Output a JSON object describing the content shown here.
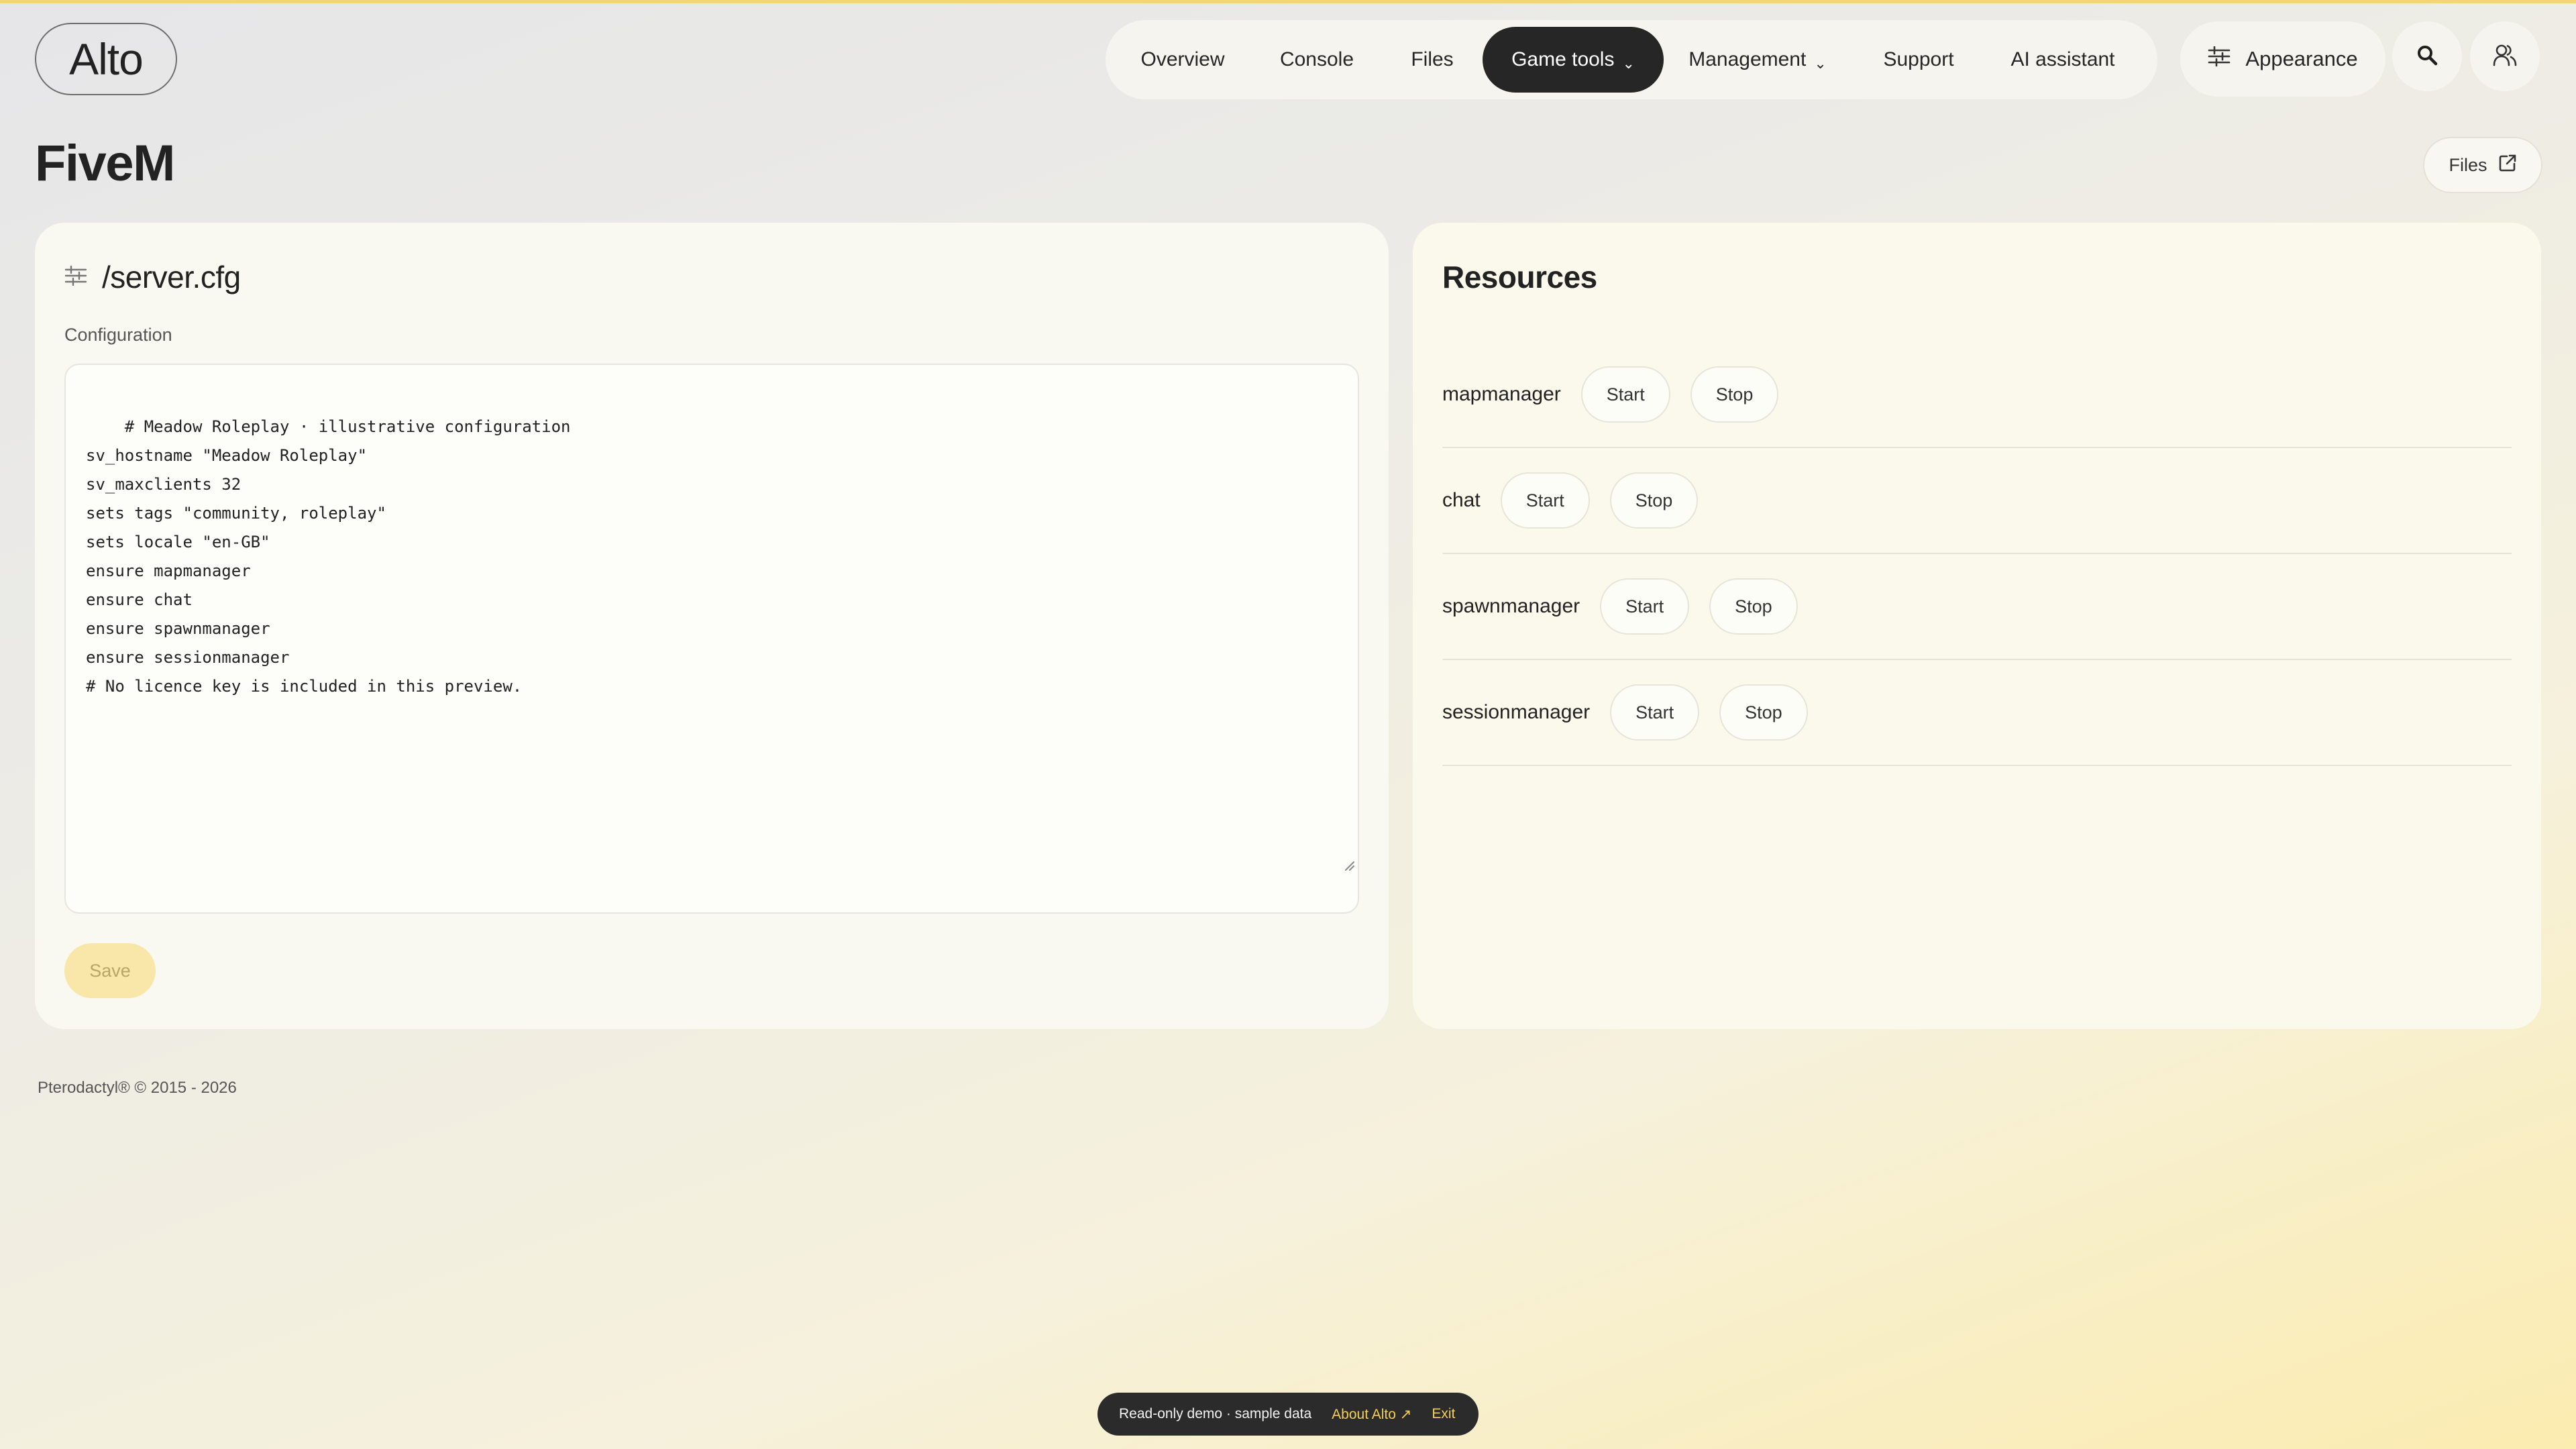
{
  "logo": {
    "text": "Alto"
  },
  "nav": {
    "items": [
      {
        "label": "Overview"
      },
      {
        "label": "Console"
      },
      {
        "label": "Files"
      },
      {
        "label": "Game tools",
        "active": true
      },
      {
        "label": "Management"
      },
      {
        "label": "Support"
      },
      {
        "label": "AI assistant"
      }
    ],
    "appearance_label": "Appearance"
  },
  "page": {
    "title": "FiveM",
    "files_link_label": "Files"
  },
  "config": {
    "title": "/server.cfg",
    "label": "Configuration",
    "content": "# Meadow Roleplay · illustrative configuration\nsv_hostname \"Meadow Roleplay\"\nsv_maxclients 32\nsets tags \"community, roleplay\"\nsets locale \"en-GB\"\nensure mapmanager\nensure chat\nensure spawnmanager\nensure sessionmanager\n# No licence key is included in this preview.",
    "save_label": "Save"
  },
  "resources": {
    "title": "Resources",
    "items": [
      {
        "name": "mapmanager",
        "start_label": "Start",
        "stop_label": "Stop"
      },
      {
        "name": "chat",
        "start_label": "Start",
        "stop_label": "Stop"
      },
      {
        "name": "spawnmanager",
        "start_label": "Start",
        "stop_label": "Stop"
      },
      {
        "name": "sessionmanager",
        "start_label": "Start",
        "stop_label": "Stop"
      }
    ]
  },
  "footer": {
    "copyright": "Pterodactyl® © 2015 - 2026"
  },
  "demo_bar": {
    "text": "Read-only demo · sample data",
    "about_label": "About Alto",
    "exit_label": "Exit"
  },
  "colors": {
    "accent": "#f3cf5a",
    "nav_active_bg": "#262626",
    "save_bg": "#f8e7a9"
  }
}
